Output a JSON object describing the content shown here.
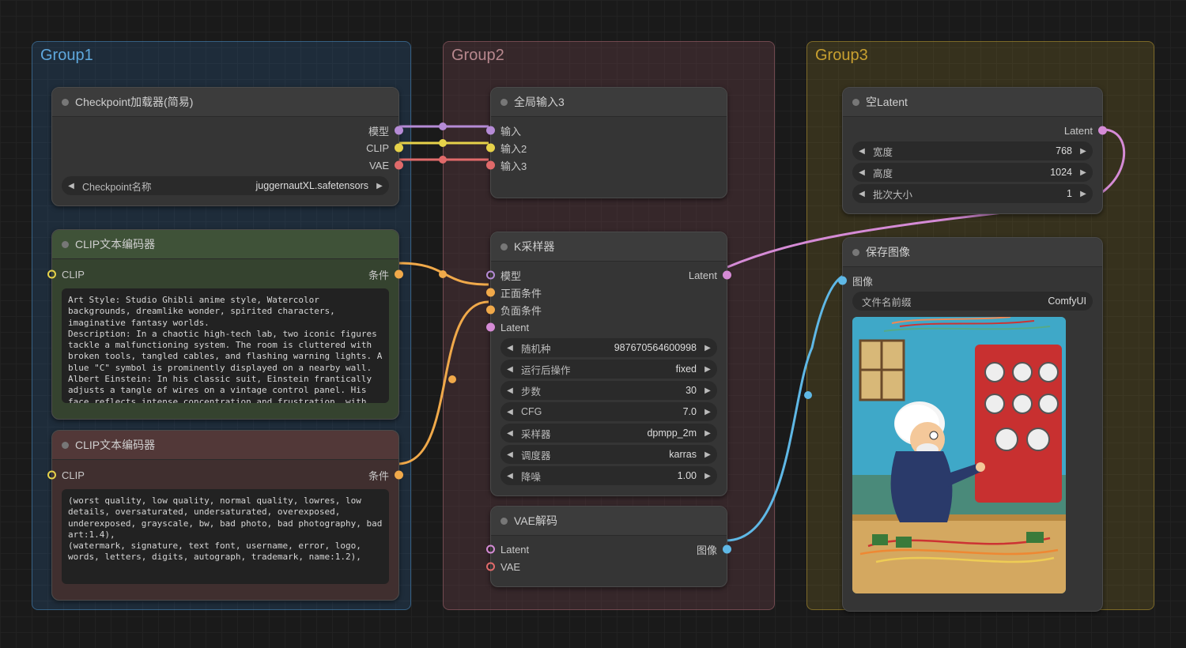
{
  "groups": {
    "g1": "Group1",
    "g2": "Group2",
    "g3": "Group3"
  },
  "nodes": {
    "checkpoint": {
      "title": "Checkpoint加载器(简易)",
      "out_model": "模型",
      "out_clip": "CLIP",
      "out_vae": "VAE",
      "ckpt_label": "Checkpoint名称",
      "ckpt_value": "juggernautXL.safetensors"
    },
    "clip_pos": {
      "title": "CLIP文本编码器",
      "in_clip": "CLIP",
      "out_cond": "条件",
      "text": "Art Style: Studio Ghibli anime style, Watercolor backgrounds, dreamlike wonder, spirited characters, imaginative fantasy worlds.\nDescription: In a chaotic high-tech lab, two iconic figures tackle a malfunctioning system. The room is cluttered with broken tools, tangled cables, and flashing warning lights. A blue \"C\" symbol is prominently displayed on a nearby wall.\nAlbert Einstein: In his classic suit, Einstein frantically adjusts a tangle of wires on a vintage control panel. His face reflects intense concentration and frustration, with sparks flying from the panel."
    },
    "clip_neg": {
      "title": "CLIP文本编码器",
      "in_clip": "CLIP",
      "out_cond": "条件",
      "text": "(worst quality, low quality, normal quality, lowres, low details, oversaturated, undersaturated, overexposed, underexposed, grayscale, bw, bad photo, bad photography, bad art:1.4),\n(watermark, signature, text font, username, error, logo, words, letters, digits, autograph, trademark, name:1.2),"
    },
    "global_in": {
      "title": "全局输入3",
      "in1": "输入",
      "in2": "输入2",
      "in3": "输入3"
    },
    "ksampler": {
      "title": "K采样器",
      "in_model": "模型",
      "in_pos": "正面条件",
      "in_neg": "负面条件",
      "in_latent": "Latent",
      "out_latent": "Latent",
      "seed_l": "随机种",
      "seed_v": "987670564600998",
      "after_l": "运行后操作",
      "after_v": "fixed",
      "steps_l": "步数",
      "steps_v": "30",
      "cfg_l": "CFG",
      "cfg_v": "7.0",
      "sampler_l": "采样器",
      "sampler_v": "dpmpp_2m",
      "sched_l": "调度器",
      "sched_v": "karras",
      "denoise_l": "降噪",
      "denoise_v": "1.00"
    },
    "vae_decode": {
      "title": "VAE解码",
      "in_latent": "Latent",
      "in_vae": "VAE",
      "out_image": "图像"
    },
    "empty_latent": {
      "title": "空Latent",
      "out_latent": "Latent",
      "w_l": "宽度",
      "w_v": "768",
      "h_l": "高度",
      "h_v": "1024",
      "b_l": "批次大小",
      "b_v": "1"
    },
    "save_image": {
      "title": "保存图像",
      "in_image": "图像",
      "prefix_l": "文件名前缀",
      "prefix_v": "ComfyUI"
    }
  }
}
